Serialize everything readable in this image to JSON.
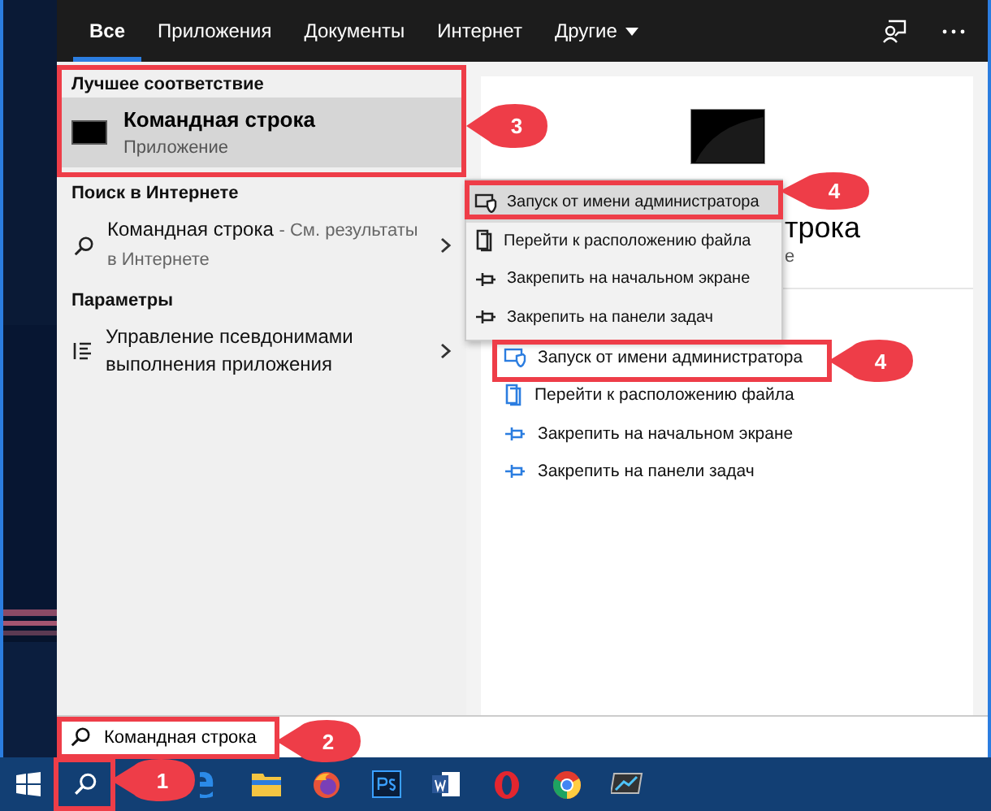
{
  "tabs": [
    {
      "label": "Все",
      "selected": true,
      "dropdown": false
    },
    {
      "label": "Приложения",
      "selected": false,
      "dropdown": false
    },
    {
      "label": "Документы",
      "selected": false,
      "dropdown": false
    },
    {
      "label": "Интернет",
      "selected": false,
      "dropdown": false
    },
    {
      "label": "Другие",
      "selected": false,
      "dropdown": true
    }
  ],
  "best_match": {
    "heading": "Лучшее соответствие",
    "title": "Командная строка",
    "subtitle": "Приложение",
    "selected": true
  },
  "web_search": {
    "heading": "Поиск в Интернете",
    "title": "Командная строка",
    "suffix": "- См. результаты в Интернете"
  },
  "settings": {
    "heading": "Параметры",
    "title": "Управление псевдонимами выполнения приложения"
  },
  "preview": {
    "title": "трока",
    "subtitle": "е",
    "actions": [
      {
        "label": "Запуск от имени администратора",
        "kind": "admin"
      },
      {
        "label": "Перейти к расположению файла",
        "kind": "folder"
      },
      {
        "label": "Закрепить на начальном экране",
        "kind": "pin"
      },
      {
        "label": "Закрепить на панели задач",
        "kind": "pin"
      }
    ]
  },
  "context_menu": {
    "items": [
      {
        "label": "Запуск от имени администратора",
        "kind": "admin",
        "selected": true
      },
      {
        "label": "Перейти к расположению файла",
        "kind": "folder",
        "selected": false
      },
      {
        "label": "Закрепить на начальном экране",
        "kind": "pin",
        "selected": false
      },
      {
        "label": "Закрепить на панели задач",
        "kind": "pin",
        "selected": false
      }
    ]
  },
  "search_box": {
    "value": "Командная строка"
  },
  "annotations": [
    {
      "number": "3"
    },
    {
      "number": "4"
    },
    {
      "number": "4"
    },
    {
      "number": "2"
    },
    {
      "number": "1"
    }
  ]
}
